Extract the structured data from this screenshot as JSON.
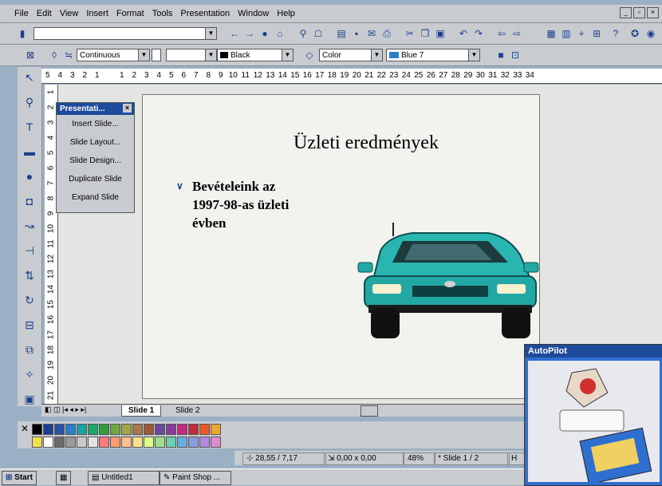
{
  "menubar": {
    "items": [
      "File",
      "Edit",
      "View",
      "Insert",
      "Format",
      "Tools",
      "Presentation",
      "Window",
      "Help"
    ]
  },
  "window_buttons": [
    "_",
    "▫",
    "×"
  ],
  "toolbar1": {
    "icons": [
      "new-doc-icon",
      "arrow-left-icon",
      "arrow-right-icon",
      "stop-icon",
      "home-icon",
      "search-icon",
      "bookmark-icon",
      "open-icon",
      "save-icon",
      "print-icon",
      "cut-icon",
      "copy-icon",
      "paste-icon",
      "undo-icon",
      "redo-icon",
      "insert-icon",
      "table-icon",
      "plus-icon",
      "chart-icon",
      "help-icon"
    ]
  },
  "toolbar2": {
    "line_style": "Continuous",
    "line_color": "Black",
    "area_style": "Color",
    "area_color": "Blue 7"
  },
  "hruler": [
    "5",
    "4",
    "3",
    "2",
    "1",
    "",
    "1",
    "2",
    "3",
    "4",
    "5",
    "6",
    "7",
    "8",
    "9",
    "10",
    "11",
    "12",
    "13",
    "14",
    "15",
    "16",
    "17",
    "18",
    "19",
    "20",
    "21",
    "22",
    "23",
    "24",
    "25",
    "26",
    "27",
    "28",
    "29",
    "30",
    "31",
    "32",
    "33",
    "34"
  ],
  "vruler": [
    "1",
    "2",
    "3",
    "4",
    "5",
    "6",
    "7",
    "8",
    "9",
    "10",
    "11",
    "12",
    "13",
    "14",
    "15",
    "16",
    "17",
    "18",
    "19",
    "20",
    "21"
  ],
  "floating_menu": {
    "title": "Presentati...",
    "items": [
      "Insert Slide...",
      "Slide Layout...",
      "Slide Design...",
      "Duplicate Slide",
      "Expand Slide"
    ]
  },
  "slide": {
    "title": "Üzleti eredmények",
    "bullet_lines": [
      "Bevételeink az",
      "1997-98-as üzleti",
      "évben"
    ]
  },
  "tabs": {
    "active": "Slide 1",
    "other": "Slide 2"
  },
  "palette_colors": [
    "#000000",
    "#1c3f8e",
    "#2c4fa8",
    "#2a7fc5",
    "#18a5a5",
    "#1fa86a",
    "#2f9f3a",
    "#6fa83f",
    "#a2a84a",
    "#a8784a",
    "#9c5a3a",
    "#6a4a9c",
    "#8a3a9c",
    "#c52a7a",
    "#c52a3a",
    "#e85a2a",
    "#f0a62a",
    "#f0e04a",
    "#ffffff",
    "#6a6a6a",
    "#9a9a9a",
    "#c9c9c9",
    "#e5e5e5",
    "#ff7a7a",
    "#ff9a6a",
    "#ffbf8a",
    "#ffe08a",
    "#dfff8a",
    "#9ae08a",
    "#6ad0b0",
    "#6ab0e0",
    "#8a9ae0",
    "#b08ae0",
    "#e08ad0"
  ],
  "status": {
    "position": "28,55 / 7,17",
    "size": "0,00 x 0,00",
    "zoom": "48%",
    "slide": "Slide 1 / 2",
    "extra": "H"
  },
  "taskbar": {
    "start": "Start",
    "tasks": [
      "Untitled1",
      "Paint Shop ..."
    ]
  },
  "autopilot": {
    "title": "AutoPilot"
  }
}
